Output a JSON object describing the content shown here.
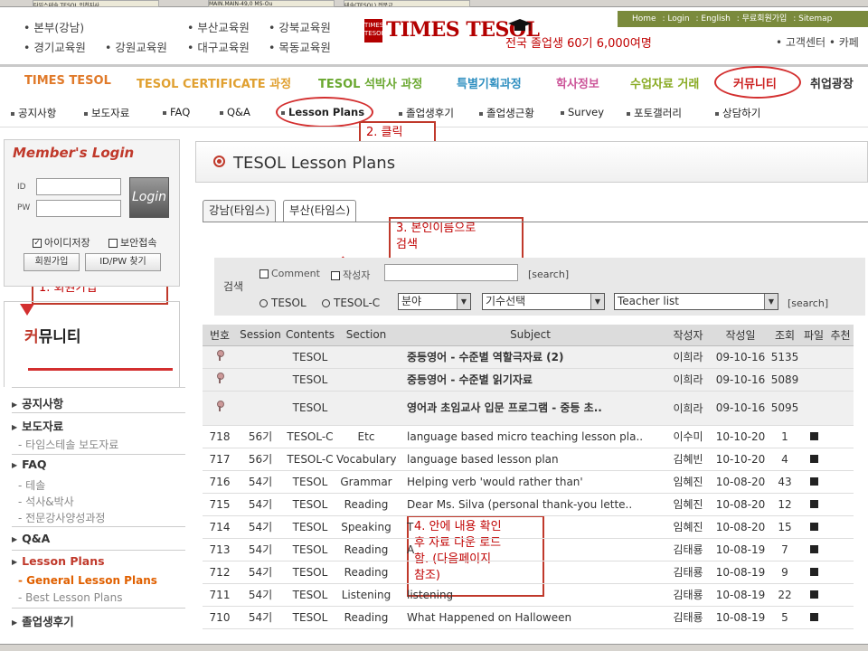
{
  "taskbar_top": [
    "타임스테솔 TESOL 인천지사",
    "MAIN.MAIN-49,0 MS-Ou",
    "테솔(TESOL) 전문교..."
  ],
  "header": {
    "regions": [
      [
        "• 본부(강남)",
        "• 경기교육원",
        "• 강원교육원"
      ],
      [
        "• 부산교육원",
        "• 대구교육원"
      ],
      [
        "• 강북교육원",
        "• 목동교육원"
      ]
    ],
    "logo_badge": "TIMES TESOL",
    "logo_text": "TIMES TESOL",
    "graduates": "전국 졸업생 60기 6,000여명",
    "util_links": [
      "Home",
      "Login",
      "English",
      "무료회원가입",
      "Sitemap"
    ],
    "util_links2": "• 고객센터  • 카페"
  },
  "main_nav": [
    {
      "label": "TIMES TESOL",
      "color": "#e07a2a"
    },
    {
      "label": "TESOL CERTIFICATE 과정",
      "color": "#e0a030"
    },
    {
      "label": "TESOL 석박사 과정",
      "color": "#6aa830"
    },
    {
      "label": "특별기획과정",
      "color": "#2f8fc0"
    },
    {
      "label": "학사정보",
      "color": "#cc5599"
    },
    {
      "label": "수업자료 거래",
      "color": "#88aa22"
    },
    {
      "label": "커뮤니티",
      "color": "#cc2222"
    },
    {
      "label": "취업광장",
      "color": "#333333"
    }
  ],
  "sub_nav": [
    "공지사항",
    "보도자료",
    "FAQ",
    "Q&A",
    "Lesson Plans",
    "졸업생후기",
    "졸업생근황",
    "Survey",
    "포토갤러리",
    "상담하기"
  ],
  "annotations": {
    "step1": "1. 회원가입",
    "step2": "2. 클릭",
    "step3": "3. 본인이름으로\n검색",
    "step4": "4. 안에 내용 확인\n후 자료 다운 로드\n함. (다음페이지\n참조)"
  },
  "login": {
    "title": "Member's Login",
    "id_label": "ID",
    "pw_label": "PW",
    "login_button": "Login",
    "save_id": "아이디저장",
    "secure": "보안접속",
    "join_button": "회원가입",
    "find_button": "ID/PW 찾기"
  },
  "sidebar": {
    "title_first": "커",
    "title_rest": "뮤니티",
    "items": [
      {
        "label": "공지사항",
        "type": "main"
      },
      {
        "label": "보도자료",
        "type": "main"
      },
      {
        "label": "타임스테솔 보도자료",
        "type": "sub"
      },
      {
        "label": "FAQ",
        "type": "main"
      },
      {
        "label": "테솔",
        "type": "sub"
      },
      {
        "label": "석사&박사",
        "type": "sub"
      },
      {
        "label": "전문강사양성과정",
        "type": "sub"
      },
      {
        "label": "Q&A",
        "type": "main"
      },
      {
        "label": "Lesson Plans",
        "type": "main"
      },
      {
        "label": "General Lesson Plans",
        "type": "sub"
      },
      {
        "label": "Best Lesson Plans",
        "type": "sub"
      },
      {
        "label": "졸업생후기",
        "type": "main"
      }
    ]
  },
  "content": {
    "title": "TESOL Lesson Plans",
    "tabs": [
      "강남(타임스)",
      "부산(타임스)"
    ],
    "search": {
      "label": "검색",
      "comment": "Comment",
      "author": "작성자",
      "search_btn": "[search]",
      "radio_tesol": "TESOL",
      "radio_tesolc": "TESOL-C",
      "field_select": "분야",
      "term_select": "기수선택",
      "teacher_select": "Teacher list",
      "search_btn2": "[search]"
    }
  },
  "table": {
    "columns": [
      "번호",
      "Session",
      "Contents",
      "Section",
      "Subject",
      "작성자",
      "작성일",
      "조회",
      "파일",
      "추천"
    ],
    "rows": [
      {
        "no": "",
        "notice": true,
        "session": "",
        "contents": "TESOL",
        "section": "",
        "subject": "중등영어 - 수준별 역할극자료 (2)",
        "author": "이희라",
        "date": "09-10-16",
        "views": "5135",
        "file": false
      },
      {
        "no": "",
        "notice": true,
        "session": "",
        "contents": "TESOL",
        "section": "",
        "subject": "중등영어 - 수준별 읽기자료",
        "author": "이희라",
        "date": "09-10-16",
        "views": "5089",
        "file": false
      },
      {
        "no": "",
        "notice": true,
        "session": "",
        "contents": "TESOL",
        "section": "",
        "subject": "영어과 초임교사 입문 프로그램 - 중등 초..",
        "author": "이희라",
        "date": "09-10-16",
        "views": "5095",
        "file": false
      },
      {
        "no": "718",
        "notice": false,
        "session": "56기",
        "contents": "TESOL-C",
        "section": "Etc",
        "subject": "language based micro teaching lesson pla..",
        "author": "이수미",
        "date": "10-10-20",
        "views": "1",
        "file": true
      },
      {
        "no": "717",
        "notice": false,
        "session": "56기",
        "contents": "TESOL-C",
        "section": "Vocabulary",
        "subject": "language based lesson plan",
        "author": "김혜빈",
        "date": "10-10-20",
        "views": "4",
        "file": true
      },
      {
        "no": "716",
        "notice": false,
        "session": "54기",
        "contents": "TESOL",
        "section": "Grammar",
        "subject": "Helping verb 'would rather than'",
        "author": "임혜진",
        "date": "10-08-20",
        "views": "43",
        "file": true
      },
      {
        "no": "715",
        "notice": false,
        "session": "54기",
        "contents": "TESOL",
        "section": "Reading",
        "subject": "Dear Ms. Silva (personal thank-you lette..",
        "author": "임혜진",
        "date": "10-08-20",
        "views": "12",
        "file": true
      },
      {
        "no": "714",
        "notice": false,
        "session": "54기",
        "contents": "TESOL",
        "section": "Speaking",
        "subject": "T",
        "author": "임혜진",
        "date": "10-08-20",
        "views": "15",
        "file": true
      },
      {
        "no": "713",
        "notice": false,
        "session": "54기",
        "contents": "TESOL",
        "section": "Reading",
        "subject": "A",
        "author": "김태룡",
        "date": "10-08-19",
        "views": "7",
        "file": true
      },
      {
        "no": "712",
        "notice": false,
        "session": "54기",
        "contents": "TESOL",
        "section": "Reading",
        "subject": "",
        "author": "김태룡",
        "date": "10-08-19",
        "views": "9",
        "file": true
      },
      {
        "no": "711",
        "notice": false,
        "session": "54기",
        "contents": "TESOL",
        "section": "Listening",
        "subject": "listening",
        "author": "김태룡",
        "date": "10-08-19",
        "views": "22",
        "file": true
      },
      {
        "no": "710",
        "notice": false,
        "session": "54기",
        "contents": "TESOL",
        "section": "Reading",
        "subject": "What Happened on Halloween",
        "author": "김태룡",
        "date": "10-08-19",
        "views": "5",
        "file": true
      }
    ]
  },
  "status_bar": "",
  "colors": {
    "accent": "#c0392b",
    "util_bar": "#7a8a3c"
  }
}
